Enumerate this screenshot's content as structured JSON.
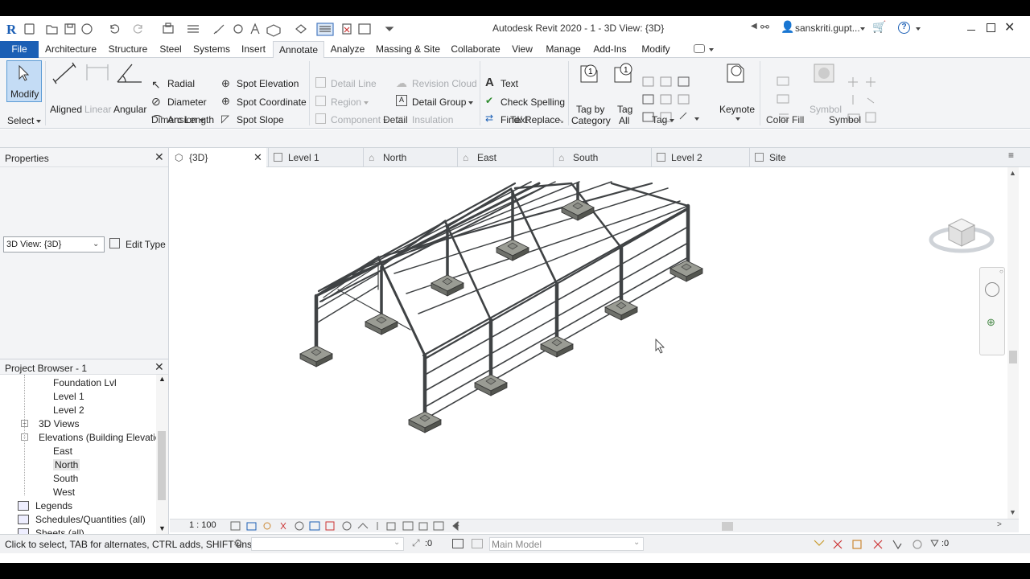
{
  "title_bar": {
    "title": "Autodesk Revit 2020 - 1 - 3D View: {3D}",
    "user": "sanskriti.gupt..."
  },
  "ribbon_tabs": [
    "File",
    "Architecture",
    "Structure",
    "Steel",
    "Systems",
    "Insert",
    "Annotate",
    "Analyze",
    "Massing & Site",
    "Collaborate",
    "View",
    "Manage",
    "Add-Ins",
    "Modify"
  ],
  "ribbon": {
    "select": {
      "modify": "Modify",
      "select_label": "Select"
    },
    "dimension": {
      "aligned": "Aligned",
      "linear": "Linear",
      "angular": "Angular",
      "radial": "Radial",
      "diameter": "Diameter",
      "arc_length": "Arc  Length",
      "spot_elevation": "Spot Elevation",
      "spot_coordinate": "Spot  Coordinate",
      "spot_slope": "Spot  Slope",
      "panel": "Dimension"
    },
    "detail": {
      "detail_line": "Detail  Line",
      "region": "Region",
      "component": "Component",
      "revision_cloud": "Revision  Cloud",
      "detail_group": "Detail  Group",
      "insulation": "Insulation",
      "panel": "Detail"
    },
    "text": {
      "text": "Text",
      "check_spelling": "Check  Spelling",
      "find_replace": "Find/  Replace",
      "panel": "Text"
    },
    "tag": {
      "tag_by_category_1": "Tag by",
      "tag_by_category_2": "Category",
      "tag_all_1": "Tag",
      "tag_all_2": "All",
      "keynote": "Keynote",
      "panel": "Tag"
    },
    "color_fill": {
      "panel": "Color Fill"
    },
    "symbol": {
      "symbol": "Symbol",
      "panel": "Symbol"
    }
  },
  "properties": {
    "title": "Properties",
    "type_selector": "3D View: {3D}",
    "edit_type": "Edit Type"
  },
  "view_tabs": [
    {
      "label": "{3D}",
      "icon": "3d-view-icon"
    },
    {
      "label": "Level 1",
      "icon": "floor-plan-icon"
    },
    {
      "label": "North",
      "icon": "elevation-icon"
    },
    {
      "label": "East",
      "icon": "elevation-icon"
    },
    {
      "label": "South",
      "icon": "elevation-icon"
    },
    {
      "label": "Level 2",
      "icon": "floor-plan-icon"
    },
    {
      "label": "Site",
      "icon": "site-plan-icon"
    }
  ],
  "project_browser": {
    "title": "Project Browser - 1",
    "items": [
      {
        "label": "Foundation Lvl",
        "indent": 3
      },
      {
        "label": "Level 1",
        "indent": 3
      },
      {
        "label": "Level 2",
        "indent": 3
      },
      {
        "label": "3D Views",
        "indent": 1,
        "expander": "+"
      },
      {
        "label": "Elevations (Building Elevation",
        "indent": 1,
        "expander": "-"
      },
      {
        "label": "East",
        "indent": 2
      },
      {
        "label": "North",
        "indent": 2,
        "selected": true
      },
      {
        "label": "South",
        "indent": 2
      },
      {
        "label": "West",
        "indent": 2
      },
      {
        "label": "Legends",
        "indent": 0,
        "icon": "legend-icon"
      },
      {
        "label": "Schedules/Quantities (all)",
        "indent": 0,
        "icon": "schedule-icon"
      },
      {
        "label": "Sheets (all)",
        "indent": 0,
        "icon": "sheet-icon"
      }
    ]
  },
  "view_control_bar": {
    "scale": "1 : 100"
  },
  "status_bar": {
    "hint": "Click to select, TAB for alternates, CTRL adds, SHIFT unse",
    "worksharing_value": ":0",
    "model": "Main Model",
    "filter_count": ":0"
  },
  "colors": {
    "accent": "#1b5fb5",
    "ribbon_bg": "#f3f4f6",
    "steel": "#4a4d4f",
    "footing": "#7c7f78"
  }
}
